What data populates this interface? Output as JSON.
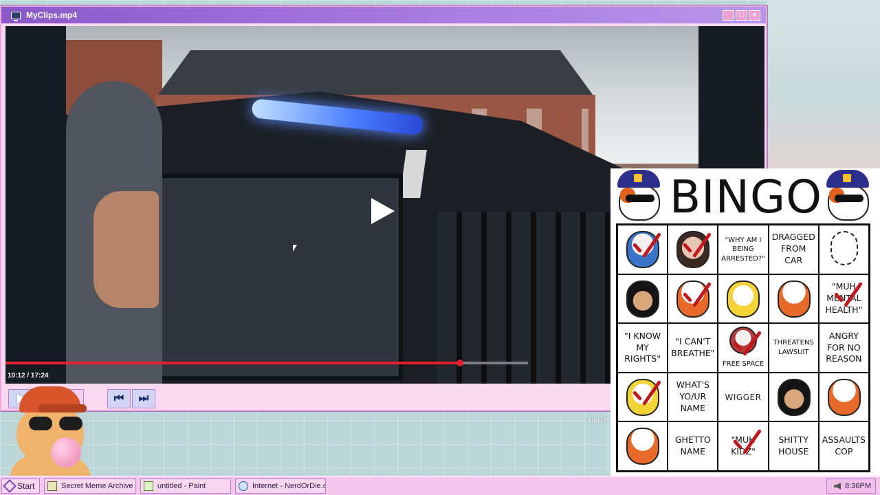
{
  "window": {
    "title": "MyClips.mp4",
    "minimize": "_",
    "maximize": "□",
    "close": "×"
  },
  "player": {
    "time": "10:12 / 17:24",
    "progress": 0.87,
    "controls": {
      "prev": "⏮",
      "next": "⏭"
    }
  },
  "desktop_icon": {
    "label": "New F"
  },
  "bingo": {
    "title": "BINGO",
    "cells": [
      {
        "text": "",
        "mascot": "blue",
        "checked": true
      },
      {
        "text": "",
        "mascot": "girl",
        "checked": true
      },
      {
        "text": "\"WHY AM I\nBEING\nARRESTED?\"",
        "small": true,
        "checked": false
      },
      {
        "text": "DRAGGED\nFROM\nCAR",
        "checked": false
      },
      {
        "text": "",
        "mascot": "outline",
        "checked": false
      },
      {
        "text": "",
        "mascot": "black",
        "checked": false
      },
      {
        "text": "",
        "mascot": "orange",
        "checked": true
      },
      {
        "text": "",
        "mascot": "yellow",
        "checked": false
      },
      {
        "text": "",
        "mascot": "orange",
        "checked": false
      },
      {
        "text": "\"MUH\nMENTAL\nHEALTH\"",
        "checked": true
      },
      {
        "text": "\"I KNOW\nMY\nRIGHTS\"",
        "checked": false
      },
      {
        "text": "\"I CAN'T\nBREATHE\"",
        "checked": false
      },
      {
        "text": "FREE SPACE",
        "mascot": "free",
        "small": true,
        "free": true,
        "checked": true
      },
      {
        "text": "THREATENS\nLAWSUIT",
        "small": true,
        "checked": false
      },
      {
        "text": "ANGRY\nFOR NO\nREASON",
        "checked": false
      },
      {
        "text": "",
        "mascot": "yellow",
        "checked": true
      },
      {
        "text": "WHAT'S\nYO/UR\nNAME",
        "checked": false
      },
      {
        "text": "WIGGER",
        "thin": true,
        "checked": false
      },
      {
        "text": "",
        "mascot": "black",
        "checked": false
      },
      {
        "text": "",
        "mascot": "orange",
        "checked": false
      },
      {
        "text": "",
        "mascot": "orange",
        "checked": false
      },
      {
        "text": "GHETTO\nNAME",
        "checked": false
      },
      {
        "text": "\"MUH\nKIDZ\"",
        "checked": true
      },
      {
        "text": "SHITTY\nHOUSE",
        "checked": false
      },
      {
        "text": "ASSAULTS\nCOP",
        "checked": false
      }
    ]
  },
  "taskbar": {
    "start_label": "Start",
    "tasks": [
      {
        "label": "Secret Meme Archive",
        "icon": "folder-icon"
      },
      {
        "label": "untitled - Paint",
        "icon": "paint-icon"
      },
      {
        "label": "Internet - NerdOrDie.com",
        "icon": "globe-icon"
      }
    ],
    "clock": "8:36PM"
  },
  "colors": {
    "accent": "#9b6ad6",
    "pink": "#f5c6ec",
    "progress": "#e0202f",
    "check": "#c3171f"
  }
}
